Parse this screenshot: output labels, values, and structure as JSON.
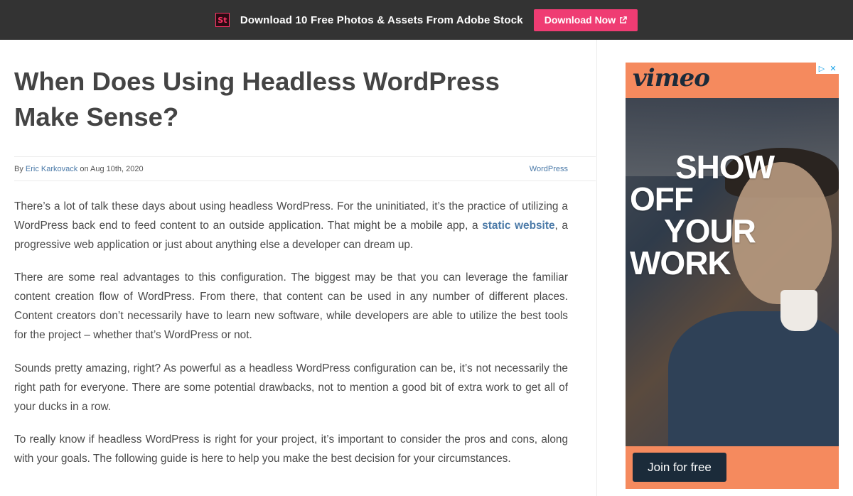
{
  "promo": {
    "icon_text": "St",
    "icon": "adobe-stock-icon",
    "text": "Download 10 Free Photos & Assets From Adobe Stock",
    "button_label": "Download Now",
    "button_icon": "external-link-icon",
    "colors": {
      "bar": "#333333",
      "button": "#ef3c73"
    }
  },
  "article": {
    "title_line1": "When Does Using Headless WordPress",
    "title_line2": "Make Sense?",
    "meta": {
      "by": "By",
      "author": "Eric Karkovack",
      "on": "on Aug 10th, 2020",
      "category": "WordPress"
    },
    "paragraphs": {
      "p1_before": "There’s a lot of talk these days about using headless WordPress. For the uninitiated, it’s the practice of utilizing a WordPress back end to feed content to an outside application. That might be a mobile app, a ",
      "p1_link": "static website",
      "p1_after": ", a progressive web application or just about anything else a developer can dream up.",
      "p2": "There are some real advantages to this configuration. The biggest may be that you can leverage the familiar content creation flow of WordPress. From there, that content can be used in any number of different places. Content creators don’t necessarily have to learn new software, while developers are able to utilize the best tools for the project – whether that’s WordPress or not.",
      "p3": "Sounds pretty amazing, right? As powerful as a headless WordPress configuration can be, it’s not necessarily the right path for everyone. There are some potential drawbacks, not to mention a good bit of extra work to get all of your ducks in a row.",
      "p4": "To really know if headless WordPress is right for your project, it’s important to consider the pros and cons, along with your goals. The following guide is here to help you make the best decision for your circumstances."
    },
    "link_color": "#4b7aa8"
  },
  "ad": {
    "brand": "vimeo",
    "headline": [
      "SHOW",
      "OFF",
      "YOUR",
      "WORK"
    ],
    "cta": "Join for free",
    "adchoices_icon": "adchoices-icon",
    "close_icon": "close-icon",
    "colors": {
      "background": "#f58a5e",
      "cta": "#1b2b3a"
    }
  }
}
